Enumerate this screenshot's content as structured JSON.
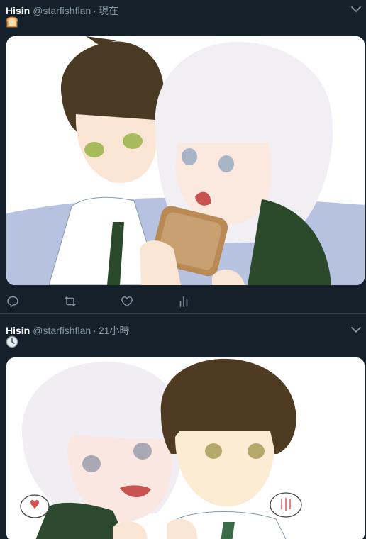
{
  "tweets": [
    {
      "author_name": "Hisin",
      "handle": "@starfishflan",
      "separator": "·",
      "time": "現在",
      "emoji": "bread-emoji",
      "image_alt": "illustration-two-characters-toast"
    },
    {
      "author_name": "Hisin",
      "handle": "@starfishflan",
      "separator": "·",
      "time": "21小時",
      "emoji": "clock-emoji",
      "image_alt": "illustration-two-characters-speech-bubbles"
    }
  ],
  "icons": {
    "reply": "reply-icon",
    "retweet": "retweet-icon",
    "like": "heart-icon",
    "analytics": "analytics-icon",
    "more": "chevron-down-icon"
  },
  "colors": {
    "background": "#15202b",
    "divider": "#38444d",
    "secondary_text": "#8899a6",
    "primary_text": "#ffffff"
  }
}
